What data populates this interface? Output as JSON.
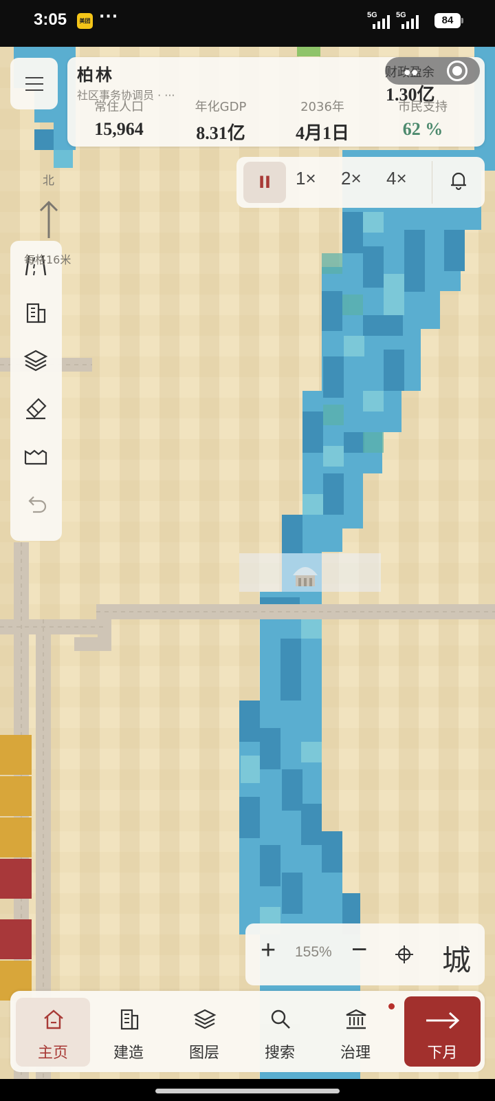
{
  "status_bar": {
    "time": "3:05",
    "app_badge": "美团",
    "more": "···",
    "signal1_label": "5G",
    "signal2_label": "5G",
    "battery": "84"
  },
  "header": {
    "city_name": "柏林",
    "role": "社区事务协调员 · ···",
    "finance_label": "财政盈余",
    "finance_value": "1.30亿",
    "stats": [
      {
        "label": "常住人口",
        "value": "15,964"
      },
      {
        "label": "年化GDP",
        "value": "8.31亿"
      },
      {
        "label": "2036年",
        "value": "4月1日"
      },
      {
        "label": "市民支持",
        "value": "62 %"
      }
    ]
  },
  "speed_controls": {
    "pause": "II",
    "speeds": [
      "1×",
      "2×",
      "4×"
    ]
  },
  "compass": {
    "north": "北",
    "scale": "每格16米"
  },
  "toolbar": {
    "icons": [
      "road-icon",
      "building-icon",
      "layers-icon",
      "eraser-icon",
      "factory-icon",
      "undo-icon"
    ]
  },
  "zoom": {
    "plus": "+",
    "level": "155%",
    "minus": "−",
    "city": "城"
  },
  "nav": {
    "items": [
      {
        "label": "主页",
        "icon": "home-icon"
      },
      {
        "label": "建造",
        "icon": "building-icon"
      },
      {
        "label": "图层",
        "icon": "layers-icon"
      },
      {
        "label": "搜索",
        "icon": "search-icon"
      },
      {
        "label": "治理",
        "icon": "government-icon"
      }
    ],
    "next": "下月"
  },
  "colors": {
    "accent_red": "#a2302d",
    "support_green": "#4d8a6e",
    "water_dark": "#3f8fb7",
    "water_light": "#6cbfd6",
    "sand": "#f1e3bf"
  }
}
